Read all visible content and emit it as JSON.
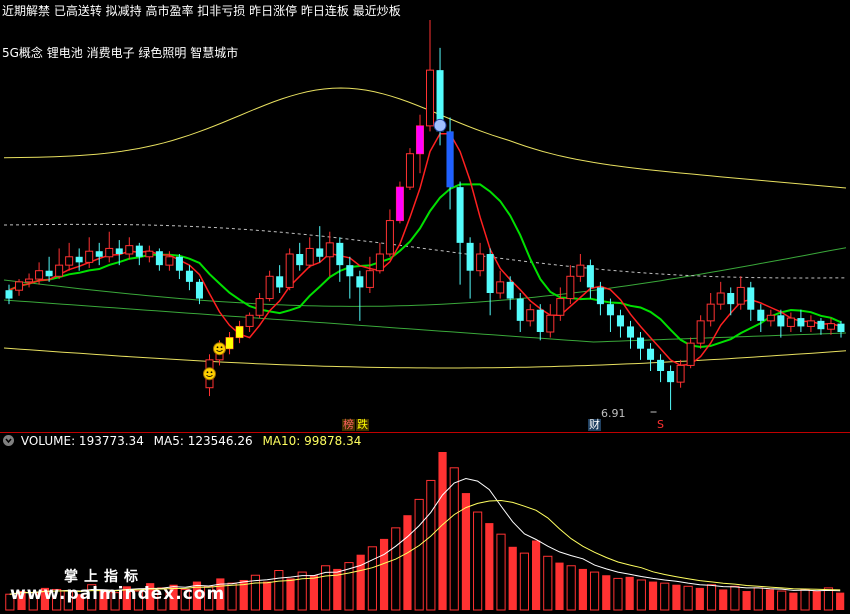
{
  "header": {
    "tags_line1": "近期解禁 已高送转 拟减持 高市盈率 扣非亏损 昨日涨停 昨日连板 最近炒板",
    "tags_line2": "5G概念 锂电池 消费电子 绿色照明 智慧城市"
  },
  "markers": {
    "low_price": "6.91",
    "bang": "榜",
    "die": "跌",
    "cai": "财",
    "s": "S"
  },
  "volume_panel": {
    "label": "VOLUME: 193773.34",
    "ma5": "MA5: 123546.26",
    "ma10": "MA10: 99878.34"
  },
  "watermark": {
    "line1": "掌上指标",
    "line2": "www.palmindex.com"
  },
  "colors": {
    "up": "#ff3232",
    "down": "#54fcfc",
    "ma_green": "#00e000",
    "ma_red": "#ff2020",
    "band_yellow": "#e8e060",
    "band_green": "#3aa83a",
    "magenta": "#ff00ff",
    "blue": "#2060ff",
    "yellow": "#ffff00"
  },
  "chart_data": [
    {
      "type": "candlestick",
      "title": "",
      "low_label": 6.91,
      "candles": [
        [
          0.4,
          0.43,
          0.38,
          0.45,
          "d"
        ],
        [
          0.43,
          0.46,
          0.41,
          0.47,
          "u"
        ],
        [
          0.46,
          0.47,
          0.44,
          0.49,
          "u"
        ],
        [
          0.47,
          0.5,
          0.45,
          0.53,
          "u"
        ],
        [
          0.5,
          0.48,
          0.46,
          0.55,
          "d"
        ],
        [
          0.48,
          0.52,
          0.47,
          0.58,
          "u"
        ],
        [
          0.52,
          0.55,
          0.5,
          0.6,
          "u"
        ],
        [
          0.55,
          0.53,
          0.5,
          0.58,
          "d"
        ],
        [
          0.53,
          0.57,
          0.51,
          0.62,
          "u"
        ],
        [
          0.57,
          0.55,
          0.52,
          0.6,
          "d"
        ],
        [
          0.55,
          0.58,
          0.53,
          0.64,
          "u"
        ],
        [
          0.58,
          0.56,
          0.52,
          0.61,
          "d"
        ],
        [
          0.56,
          0.59,
          0.54,
          0.62,
          "u"
        ],
        [
          0.59,
          0.55,
          0.52,
          0.6,
          "d"
        ],
        [
          0.55,
          0.57,
          0.53,
          0.59,
          "u"
        ],
        [
          0.57,
          0.52,
          0.5,
          0.58,
          "d"
        ],
        [
          0.52,
          0.55,
          0.5,
          0.57,
          "u"
        ],
        [
          0.55,
          0.5,
          0.47,
          0.56,
          "d"
        ],
        [
          0.5,
          0.46,
          0.43,
          0.52,
          "d"
        ],
        [
          0.46,
          0.4,
          0.38,
          0.47,
          "d"
        ],
        [
          0.08,
          0.18,
          0.05,
          0.2,
          "u"
        ],
        [
          0.18,
          0.22,
          0.16,
          0.25,
          "u"
        ],
        [
          0.22,
          0.26,
          0.2,
          0.28,
          "u"
        ],
        [
          0.26,
          0.3,
          0.24,
          0.32,
          "u"
        ],
        [
          0.3,
          0.34,
          0.28,
          0.35,
          "u"
        ],
        [
          0.34,
          0.4,
          0.33,
          0.42,
          "u"
        ],
        [
          0.4,
          0.48,
          0.39,
          0.5,
          "u"
        ],
        [
          0.48,
          0.44,
          0.42,
          0.52,
          "d"
        ],
        [
          0.44,
          0.56,
          0.43,
          0.58,
          "u"
        ],
        [
          0.56,
          0.52,
          0.5,
          0.6,
          "d"
        ],
        [
          0.52,
          0.58,
          0.51,
          0.62,
          "u"
        ],
        [
          0.58,
          0.55,
          0.53,
          0.66,
          "d"
        ],
        [
          0.55,
          0.6,
          0.48,
          0.64,
          "u"
        ],
        [
          0.6,
          0.52,
          0.46,
          0.62,
          "d"
        ],
        [
          0.52,
          0.48,
          0.4,
          0.55,
          "d"
        ],
        [
          0.48,
          0.44,
          0.32,
          0.5,
          "d"
        ],
        [
          0.44,
          0.5,
          0.42,
          0.55,
          "u"
        ],
        [
          0.5,
          0.56,
          0.49,
          0.6,
          "u"
        ],
        [
          0.56,
          0.68,
          0.55,
          0.72,
          "u"
        ],
        [
          0.68,
          0.8,
          0.67,
          0.82,
          "u"
        ],
        [
          0.8,
          0.92,
          0.79,
          0.94,
          "u"
        ],
        [
          0.92,
          1.02,
          0.85,
          1.06,
          "u"
        ],
        [
          1.02,
          1.22,
          1.0,
          1.4,
          "u"
        ],
        [
          1.22,
          1.0,
          0.95,
          1.3,
          "d"
        ],
        [
          1.0,
          0.8,
          0.72,
          1.05,
          "d"
        ],
        [
          0.8,
          0.6,
          0.45,
          0.82,
          "d"
        ],
        [
          0.6,
          0.5,
          0.4,
          0.62,
          "d"
        ],
        [
          0.5,
          0.56,
          0.48,
          0.6,
          "u"
        ],
        [
          0.56,
          0.42,
          0.34,
          0.58,
          "d"
        ],
        [
          0.42,
          0.46,
          0.4,
          0.5,
          "u"
        ],
        [
          0.46,
          0.4,
          0.36,
          0.48,
          "d"
        ],
        [
          0.4,
          0.32,
          0.28,
          0.42,
          "d"
        ],
        [
          0.32,
          0.36,
          0.3,
          0.38,
          "u"
        ],
        [
          0.36,
          0.28,
          0.25,
          0.38,
          "d"
        ],
        [
          0.28,
          0.34,
          0.26,
          0.38,
          "u"
        ],
        [
          0.34,
          0.4,
          0.32,
          0.44,
          "u"
        ],
        [
          0.4,
          0.48,
          0.38,
          0.52,
          "u"
        ],
        [
          0.48,
          0.52,
          0.46,
          0.56,
          "u"
        ],
        [
          0.52,
          0.44,
          0.4,
          0.54,
          "d"
        ],
        [
          0.44,
          0.38,
          0.34,
          0.46,
          "d"
        ],
        [
          0.38,
          0.34,
          0.28,
          0.4,
          "d"
        ],
        [
          0.34,
          0.3,
          0.26,
          0.36,
          "d"
        ],
        [
          0.3,
          0.26,
          0.22,
          0.32,
          "d"
        ],
        [
          0.26,
          0.22,
          0.18,
          0.28,
          "d"
        ],
        [
          0.22,
          0.18,
          0.14,
          0.24,
          "d"
        ],
        [
          0.18,
          0.14,
          0.1,
          0.2,
          "d"
        ],
        [
          0.14,
          0.1,
          0.0,
          0.16,
          "d"
        ],
        [
          0.1,
          0.16,
          0.08,
          0.18,
          "u"
        ],
        [
          0.16,
          0.24,
          0.15,
          0.26,
          "u"
        ],
        [
          0.24,
          0.32,
          0.22,
          0.34,
          "u"
        ],
        [
          0.32,
          0.38,
          0.3,
          0.42,
          "u"
        ],
        [
          0.38,
          0.42,
          0.36,
          0.46,
          "u"
        ],
        [
          0.42,
          0.38,
          0.34,
          0.44,
          "d"
        ],
        [
          0.38,
          0.44,
          0.36,
          0.48,
          "u"
        ],
        [
          0.44,
          0.36,
          0.32,
          0.46,
          "d"
        ],
        [
          0.36,
          0.32,
          0.28,
          0.38,
          "d"
        ],
        [
          0.32,
          0.34,
          0.3,
          0.36,
          "u"
        ],
        [
          0.34,
          0.3,
          0.26,
          0.36,
          "d"
        ],
        [
          0.3,
          0.33,
          0.28,
          0.35,
          "u"
        ],
        [
          0.33,
          0.3,
          0.28,
          0.36,
          "d"
        ],
        [
          0.3,
          0.32,
          0.28,
          0.34,
          "u"
        ],
        [
          0.32,
          0.29,
          0.27,
          0.33,
          "d"
        ],
        [
          0.29,
          0.31,
          0.27,
          0.33,
          "u"
        ],
        [
          0.31,
          0.28,
          0.26,
          0.32,
          "d"
        ]
      ],
      "volumes": [
        [
          "u",
          0.1
        ],
        [
          "d",
          0.12
        ],
        [
          "u",
          0.11
        ],
        [
          "d",
          0.14
        ],
        [
          "u",
          0.13
        ],
        [
          "u",
          0.12
        ],
        [
          "d",
          0.1
        ],
        [
          "u",
          0.16
        ],
        [
          "d",
          0.13
        ],
        [
          "u",
          0.11
        ],
        [
          "d",
          0.15
        ],
        [
          "u",
          0.12
        ],
        [
          "d",
          0.17
        ],
        [
          "u",
          0.14
        ],
        [
          "d",
          0.16
        ],
        [
          "u",
          0.13
        ],
        [
          "d",
          0.18
        ],
        [
          "u",
          0.15
        ],
        [
          "d",
          0.2
        ],
        [
          "u",
          0.17
        ],
        [
          "d",
          0.19
        ],
        [
          "u",
          0.22
        ],
        [
          "d",
          0.18
        ],
        [
          "u",
          0.25
        ],
        [
          "d",
          0.2
        ],
        [
          "u",
          0.24
        ],
        [
          "d",
          0.22
        ],
        [
          "u",
          0.28
        ],
        [
          "d",
          0.26
        ],
        [
          "u",
          0.3
        ],
        [
          "d",
          0.35
        ],
        [
          "u",
          0.4
        ],
        [
          "d",
          0.45
        ],
        [
          "u",
          0.52
        ],
        [
          "d",
          0.6
        ],
        [
          "u",
          0.7
        ],
        [
          "u",
          0.82
        ],
        [
          "d",
          1.0
        ],
        [
          "u",
          0.9
        ],
        [
          "d",
          0.74
        ],
        [
          "u",
          0.62
        ],
        [
          "d",
          0.55
        ],
        [
          "u",
          0.48
        ],
        [
          "d",
          0.4
        ],
        [
          "u",
          0.36
        ],
        [
          "d",
          0.44
        ],
        [
          "u",
          0.34
        ],
        [
          "d",
          0.3
        ],
        [
          "u",
          0.28
        ],
        [
          "d",
          0.26
        ],
        [
          "u",
          0.24
        ],
        [
          "d",
          0.22
        ],
        [
          "u",
          0.2
        ],
        [
          "d",
          0.21
        ],
        [
          "u",
          0.19
        ],
        [
          "d",
          0.18
        ],
        [
          "u",
          0.17
        ],
        [
          "d",
          0.16
        ],
        [
          "u",
          0.15
        ],
        [
          "d",
          0.14
        ],
        [
          "u",
          0.16
        ],
        [
          "d",
          0.13
        ],
        [
          "u",
          0.15
        ],
        [
          "d",
          0.12
        ],
        [
          "u",
          0.14
        ],
        [
          "d",
          0.13
        ],
        [
          "u",
          0.12
        ],
        [
          "d",
          0.11
        ],
        [
          "u",
          0.13
        ],
        [
          "d",
          0.12
        ],
        [
          "u",
          0.14
        ],
        [
          "d",
          0.11
        ]
      ]
    }
  ]
}
